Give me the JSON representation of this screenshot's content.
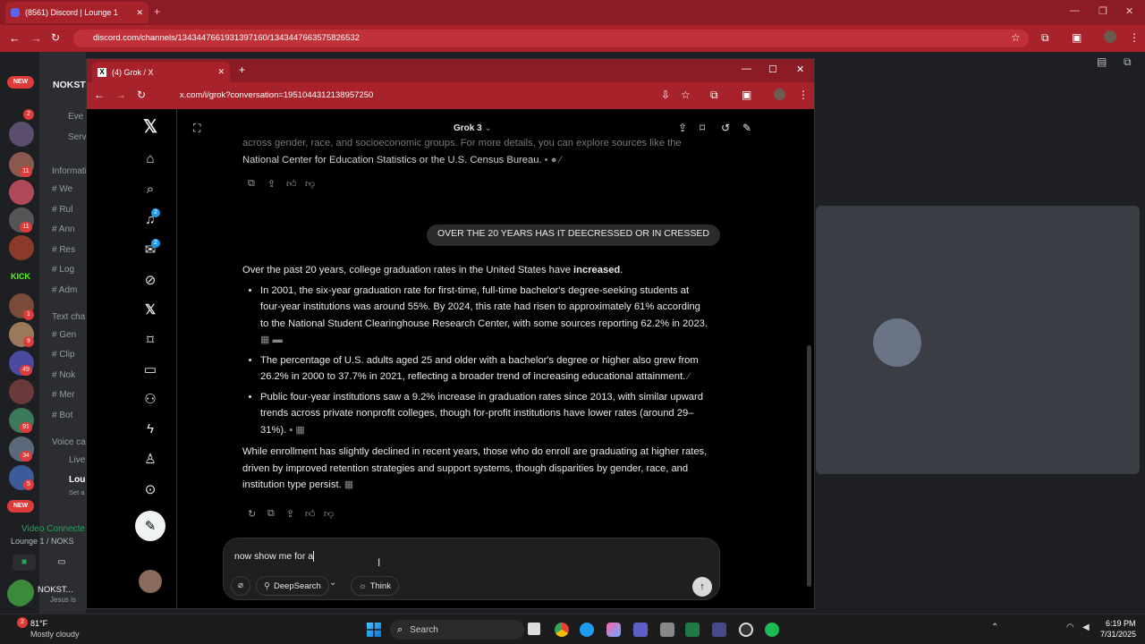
{
  "discord_browser": {
    "tab_title": "(8561) Discord | Lounge 1",
    "url": "discord.com/channels/1343447661931397160/1343447663575826532",
    "server_name": "NOKST",
    "new_badge": "NEW",
    "channels": [
      {
        "label": "Eve"
      },
      {
        "label": "Serv"
      },
      {
        "label": "Informati"
      },
      {
        "label": "# We"
      },
      {
        "label": "# Rul"
      },
      {
        "label": "# Ann"
      },
      {
        "label": "# Res"
      },
      {
        "label": "# Log"
      },
      {
        "label": "# Adm"
      },
      {
        "label": "Text cha"
      },
      {
        "label": "# Gen"
      },
      {
        "label": "# Clip"
      },
      {
        "label": "# Nok"
      },
      {
        "label": "# Mer"
      },
      {
        "label": "# Bot"
      },
      {
        "label": "Voice cal"
      },
      {
        "label": "Live"
      },
      {
        "label": "Lou"
      },
      {
        "label": "Set a"
      }
    ],
    "voice_status": "Video Connecte",
    "voice_channel": "Lounge 1 / NOKS",
    "username": "NOKST...",
    "user_status": "Jesus is",
    "kick_label": "KICK",
    "server_badges": [
      "2",
      "11",
      "11",
      "1",
      "9",
      "49",
      "91",
      "34",
      "5"
    ]
  },
  "grok_browser": {
    "tab_title": "(4) Grok / X",
    "url": "x.com/i/grok?conversation=1951044312138957250",
    "nav_badges": {
      "notifications": "2",
      "messages": "2"
    },
    "header_title": "Grok 3",
    "prev_text_line1": "across gender, race, and socioeconomic groups. For more details, you can explore sources like the",
    "prev_text_line2": "National Center for Education Statistics or the U.S. Census Bureau.",
    "user_message": "OVER THE 20 YEARS HAS IT DEECRESSED OR IN CRESSED",
    "answer_intro_pre": "Over the past 20 years, college graduation rates in the United States have ",
    "answer_intro_bold": "increased",
    "answer_intro_post": ".",
    "bullets": [
      "In 2001, the six-year graduation rate for first-time, full-time bachelor's degree-seeking students at four-year institutions was around 55%. By 2024, this rate had risen to approximately 61% according to the National Student Clearinghouse Research Center, with some sources reporting 62.2% in 2023.",
      "The percentage of U.S. adults aged 25 and older with a bachelor's degree or higher also grew from 26.2% in 2000 to 37.7% in 2021, reflecting a broader trend of increasing educational attainment.",
      "Public four-year institutions saw a 9.2% increase in graduation rates since 2013, with similar upward trends across private nonprofit colleges, though for-profit institutions have lower rates (around 29–31%)."
    ],
    "answer_outro": "While enrollment has slightly declined in recent years, those who do enroll are graduating at higher rates, driven by improved retention strategies and support systems, though disparities by gender, race, and institution type persist.",
    "composer_text": "now show me for a",
    "deepsearch_label": "DeepSearch",
    "think_label": "Think"
  },
  "taskbar": {
    "temperature": "81°F",
    "weather": "Mostly cloudy",
    "search_label": "Search",
    "time": "6:19 PM",
    "date": "7/31/2025",
    "weather_badge": "2"
  }
}
